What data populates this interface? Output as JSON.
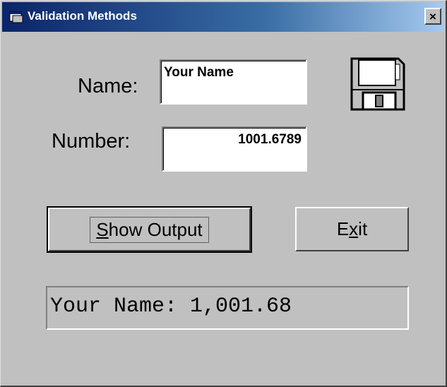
{
  "window": {
    "title": "Validation Methods",
    "close_glyph": "×"
  },
  "form": {
    "name_label": "Name:",
    "name_value": "Your Name",
    "number_label": "Number:",
    "number_value": "1001.6789"
  },
  "buttons": {
    "show_output_first": "S",
    "show_output_rest": "how Output",
    "exit_first": "E",
    "exit_mid": "x",
    "exit_rest": "it"
  },
  "output": {
    "text": "Your Name: 1,001.68"
  },
  "icons": {
    "app": "app-window-icon",
    "save": "floppy-disk-icon",
    "close": "close-icon"
  },
  "colors": {
    "title_start": "#0a246a",
    "title_end": "#a6caf0",
    "face": "#c0c0c0"
  }
}
